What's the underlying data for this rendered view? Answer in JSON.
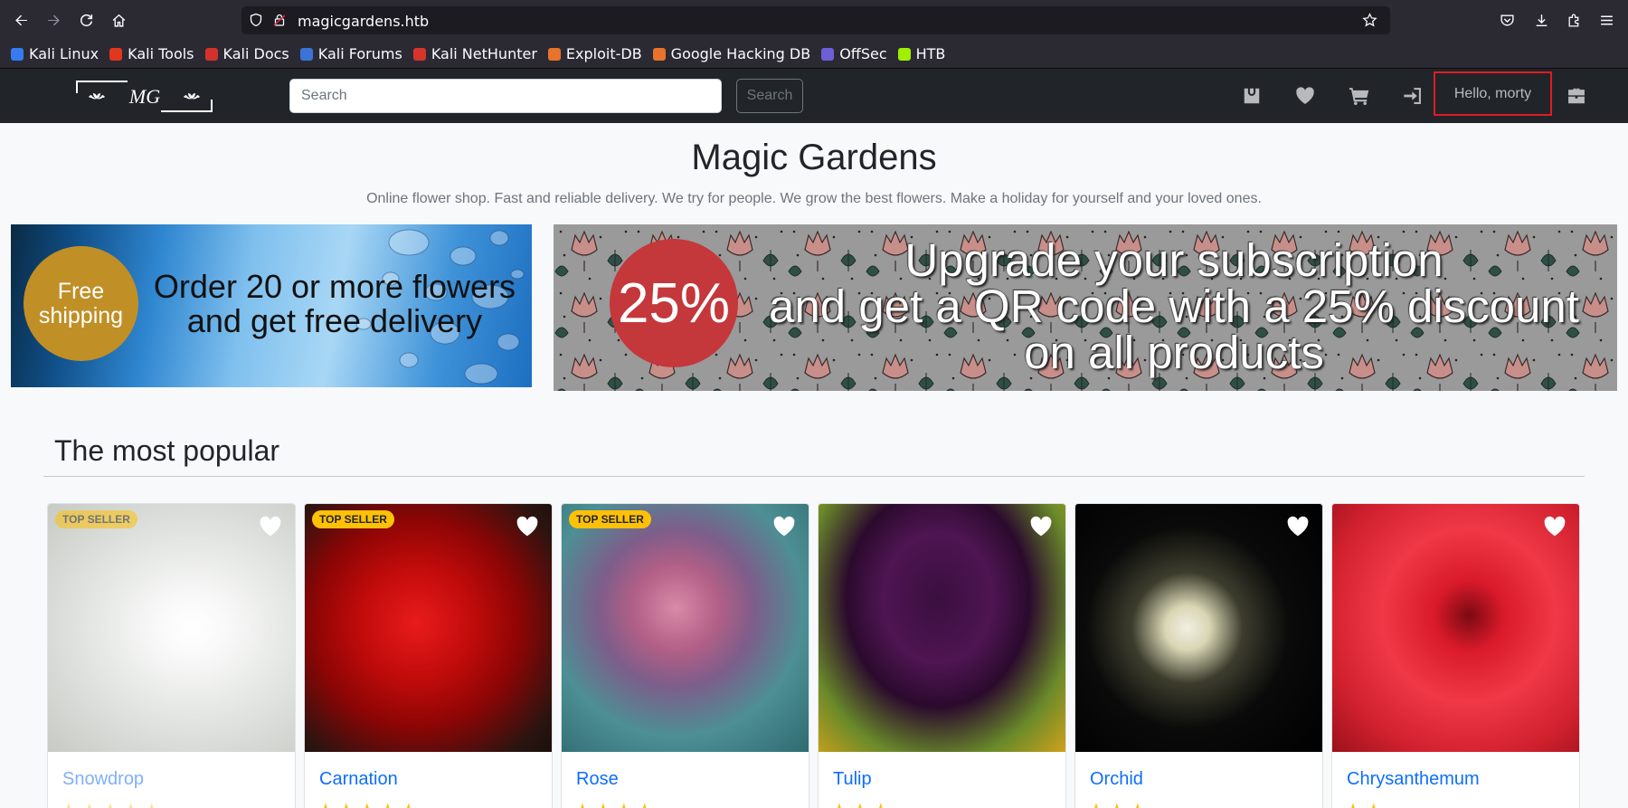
{
  "browser": {
    "url": "magicgardens.htb",
    "bookmarks": [
      {
        "label": "Kali Linux",
        "color": "#367bf0"
      },
      {
        "label": "Kali Tools",
        "color": "#e2361f"
      },
      {
        "label": "Kali Docs",
        "color": "#d3312b"
      },
      {
        "label": "Kali Forums",
        "color": "#3b73d9"
      },
      {
        "label": "Kali NetHunter",
        "color": "#d7342a"
      },
      {
        "label": "Exploit-DB",
        "color": "#e8732b"
      },
      {
        "label": "Google Hacking DB",
        "color": "#e8732b"
      },
      {
        "label": "OffSec",
        "color": "#6d5fd6"
      },
      {
        "label": "HTB",
        "color": "#9fef00"
      }
    ]
  },
  "nav": {
    "logo_text": "MG",
    "search_placeholder": "Search",
    "search_button": "Search",
    "greeting": "Hello, morty",
    "icons": [
      "bag-icon",
      "heart-icon",
      "cart-icon",
      "sign-in-icon",
      "briefcase-icon"
    ]
  },
  "hero": {
    "title": "Magic Gardens",
    "subtitle": "Online flower shop. Fast and reliable delivery. We try for people. We grow the best flowers. Make a holiday for yourself and your loved ones."
  },
  "banners": {
    "left": {
      "circle_line1": "Free",
      "circle_line2": "shipping",
      "line1": "Order 20 or more flowers",
      "line2": "and get free delivery"
    },
    "right": {
      "circle": "25%",
      "line1": "Upgrade your subscription",
      "line2": "and get a QR code with a 25% discount",
      "line3": "on all products"
    }
  },
  "popular": {
    "title": "The most popular",
    "products": [
      {
        "name": "Snowdrop",
        "badge": "TOP SELLER",
        "stars": 5,
        "muted": true
      },
      {
        "name": "Carnation",
        "badge": "TOP SELLER",
        "stars": 5
      },
      {
        "name": "Rose",
        "badge": "TOP SELLER",
        "stars": 4
      },
      {
        "name": "Tulip",
        "badge": "",
        "stars": 3
      },
      {
        "name": "Orchid",
        "badge": "",
        "stars": 3
      },
      {
        "name": "Chrysanthemum",
        "badge": "",
        "stars": 2
      }
    ]
  }
}
